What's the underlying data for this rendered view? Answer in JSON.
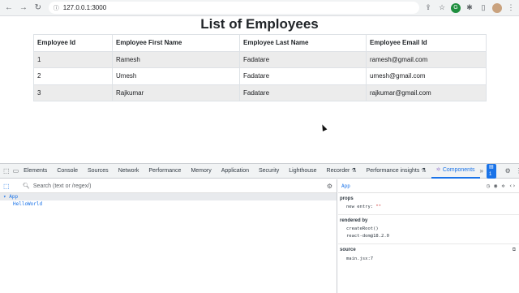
{
  "browser": {
    "url": "127.0.0.1:3000",
    "back_icon": "arrow-left-icon",
    "forward_icon": "arrow-right-icon",
    "reload_icon": "reload-icon"
  },
  "page": {
    "title": "List of Employees",
    "columns": [
      "Employee Id",
      "Employee First Name",
      "Employee Last Name",
      "Employee Email Id"
    ],
    "rows": [
      [
        "1",
        "Ramesh",
        "Fadatare",
        "ramesh@gmail.com"
      ],
      [
        "2",
        "Umesh",
        "Fadatare",
        "umesh@gmail.com"
      ],
      [
        "3",
        "Rajkumar",
        "Fadatare",
        "rajkumar@gmail.com"
      ]
    ]
  },
  "devtools": {
    "tabs": [
      "Elements",
      "Console",
      "Sources",
      "Network",
      "Performance",
      "Memory",
      "Application",
      "Security",
      "Lighthouse",
      "Recorder ⚗",
      "Performance insights ⚗",
      "Components"
    ],
    "active_tab": "Components",
    "more_tabs": "»",
    "message_count": "1",
    "search_placeholder": "Search (text or /regex/)",
    "tree": [
      {
        "label": "App",
        "prefix": "▾ "
      },
      {
        "label": "HelloWorld"
      }
    ],
    "selected_component": "App",
    "props_title": "props",
    "props_entry_key": "new entry:",
    "props_entry_value": "\"\"",
    "rendered_by_title": "rendered by",
    "rendered_by": [
      "createRoot()",
      "react-dom@18.2.0"
    ],
    "source_title": "source",
    "source_value": "main.jsx:7"
  }
}
